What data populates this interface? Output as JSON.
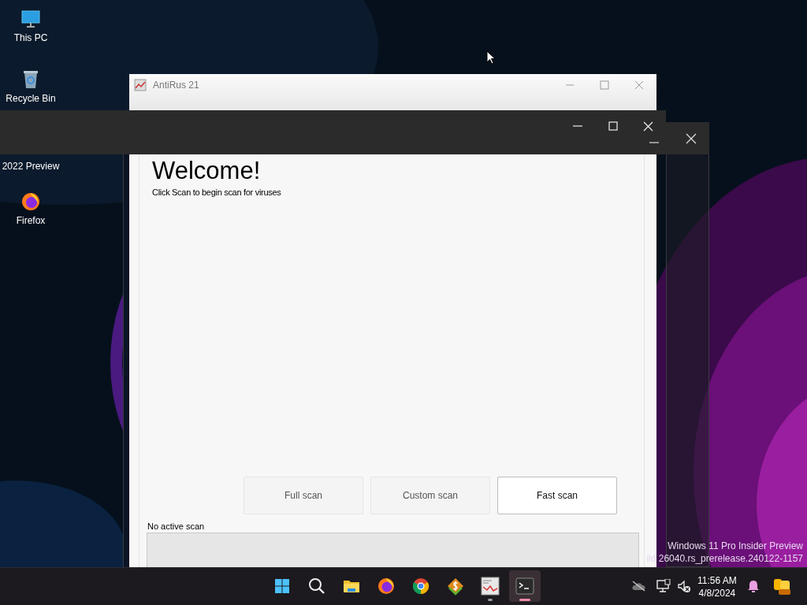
{
  "desktop_icons": [
    {
      "kind": "pc",
      "label": "This PC"
    },
    {
      "kind": "bin",
      "label": "Recycle Bin"
    },
    {
      "kind": "none",
      "label": "2022 Preview"
    },
    {
      "kind": "firefox",
      "label": "Firefox"
    }
  ],
  "app_window": {
    "title": "AntiRus 21",
    "heading": "Welcome!",
    "subtitle": "Click Scan to begin scan for viruses",
    "buttons": [
      {
        "label": "Full scan",
        "selected": false
      },
      {
        "label": "Custom scan",
        "selected": false
      },
      {
        "label": "Fast scan",
        "selected": true
      }
    ],
    "scan_status": "No active scan"
  },
  "build_info": [
    "Windows 11 Pro Insider Preview",
    "ild 26040.rs_prerelease.240122-1157"
  ],
  "taskbar": {
    "apps": [
      {
        "kind": "start",
        "running": false,
        "active": false
      },
      {
        "kind": "search",
        "running": false,
        "active": false
      },
      {
        "kind": "explorer",
        "running": false,
        "active": false
      },
      {
        "kind": "firefox",
        "running": false,
        "active": false
      },
      {
        "kind": "chrome",
        "running": false,
        "active": false
      },
      {
        "kind": "dollar",
        "running": false,
        "active": false
      },
      {
        "kind": "antirus",
        "running": true,
        "active": false
      },
      {
        "kind": "terminal",
        "running": true,
        "active": true
      }
    ],
    "clock": {
      "time": "11:56 AM",
      "date": "4/8/2024"
    }
  }
}
